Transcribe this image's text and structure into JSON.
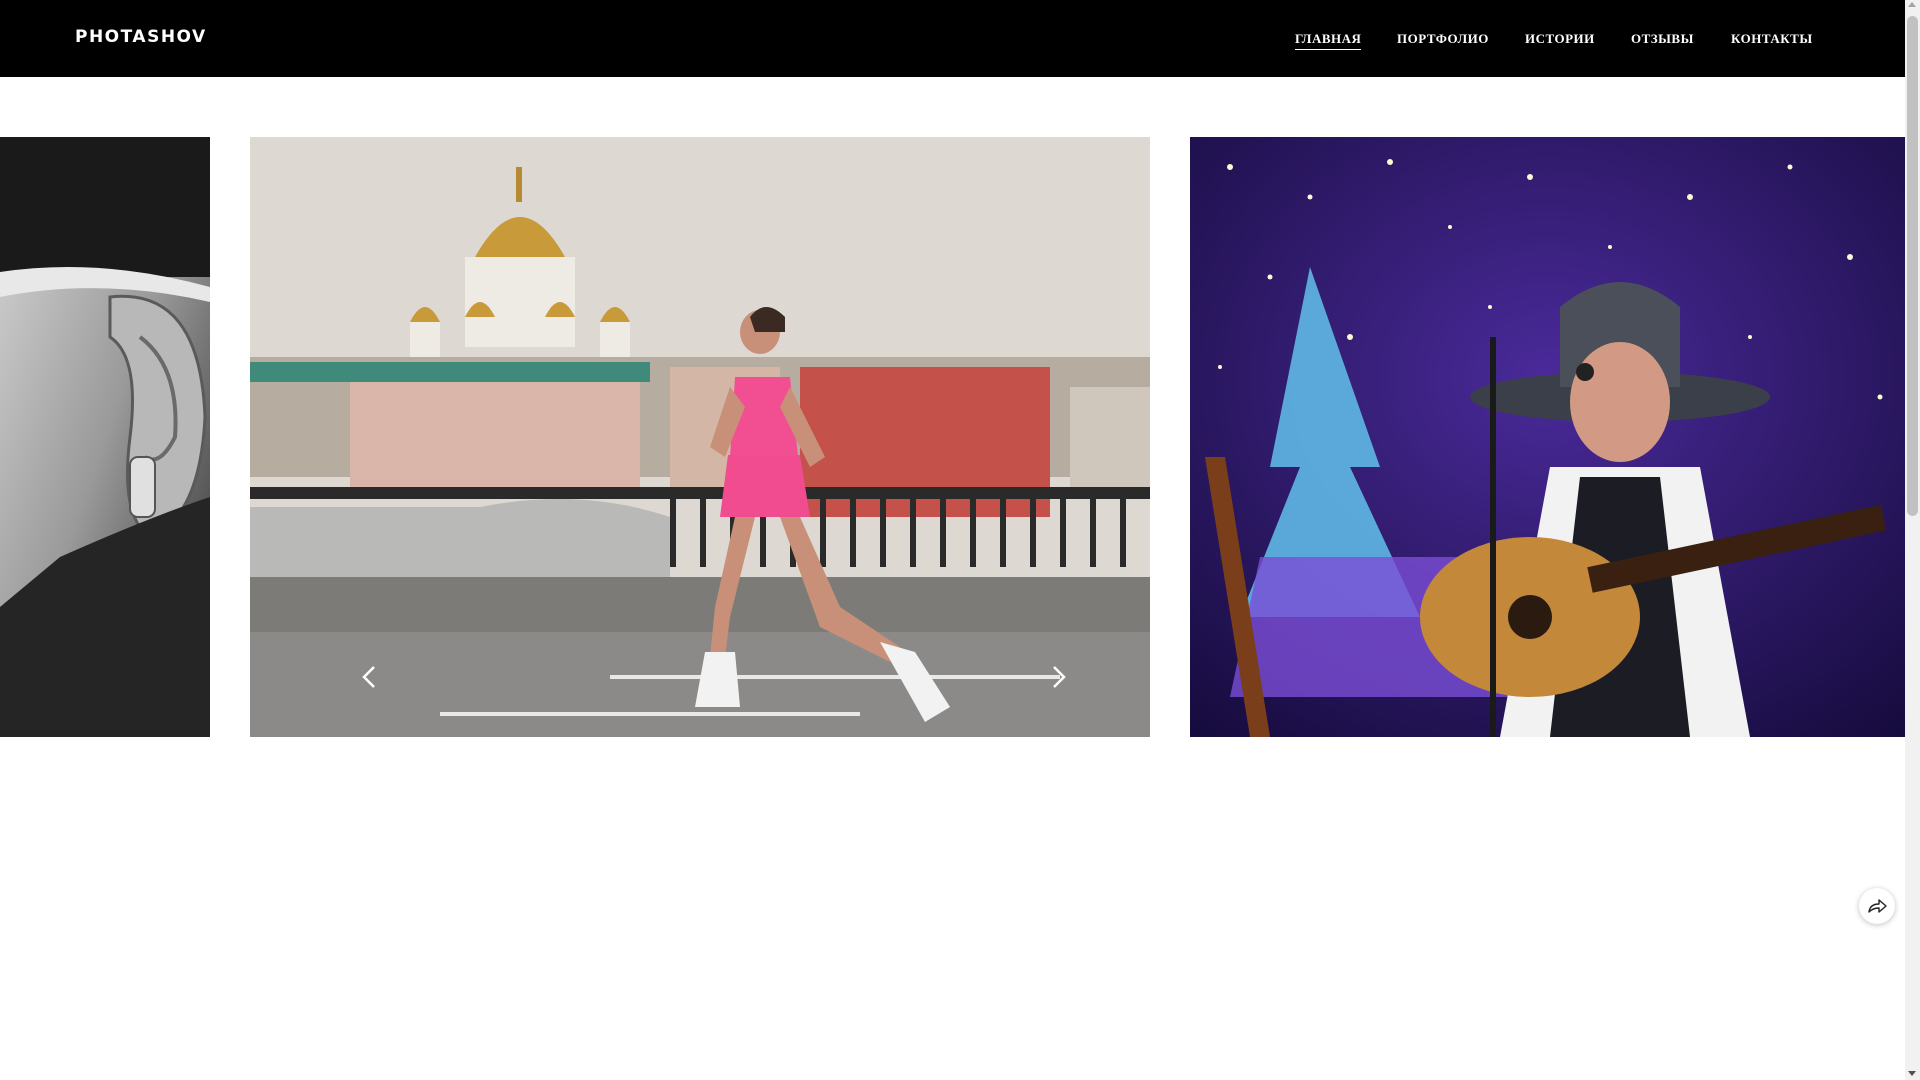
{
  "header": {
    "logo": "PHOTASHOV",
    "nav": [
      {
        "label": "ГЛАВНАЯ",
        "active": true
      },
      {
        "label": "ПОРТФОЛИО",
        "active": false
      },
      {
        "label": "ИСТОРИИ",
        "active": false
      },
      {
        "label": "ОТЗЫВЫ",
        "active": false
      },
      {
        "label": "КОНТАКТЫ",
        "active": false
      }
    ]
  },
  "slider": {
    "slides": [
      {
        "description": "black-and-white close-up of ear with earring"
      },
      {
        "description": "runner in pink outfit on embankment with cathedral behind"
      },
      {
        "description": "musician with guitar and hat singing on stage"
      }
    ],
    "prev_icon": "chevron-left-icon",
    "next_icon": "chevron-right-icon"
  },
  "share_icon": "share-arrow-icon",
  "colors": {
    "header_bg": "#000000",
    "page_bg": "#ffffff",
    "nav_text": "#ffffff"
  }
}
